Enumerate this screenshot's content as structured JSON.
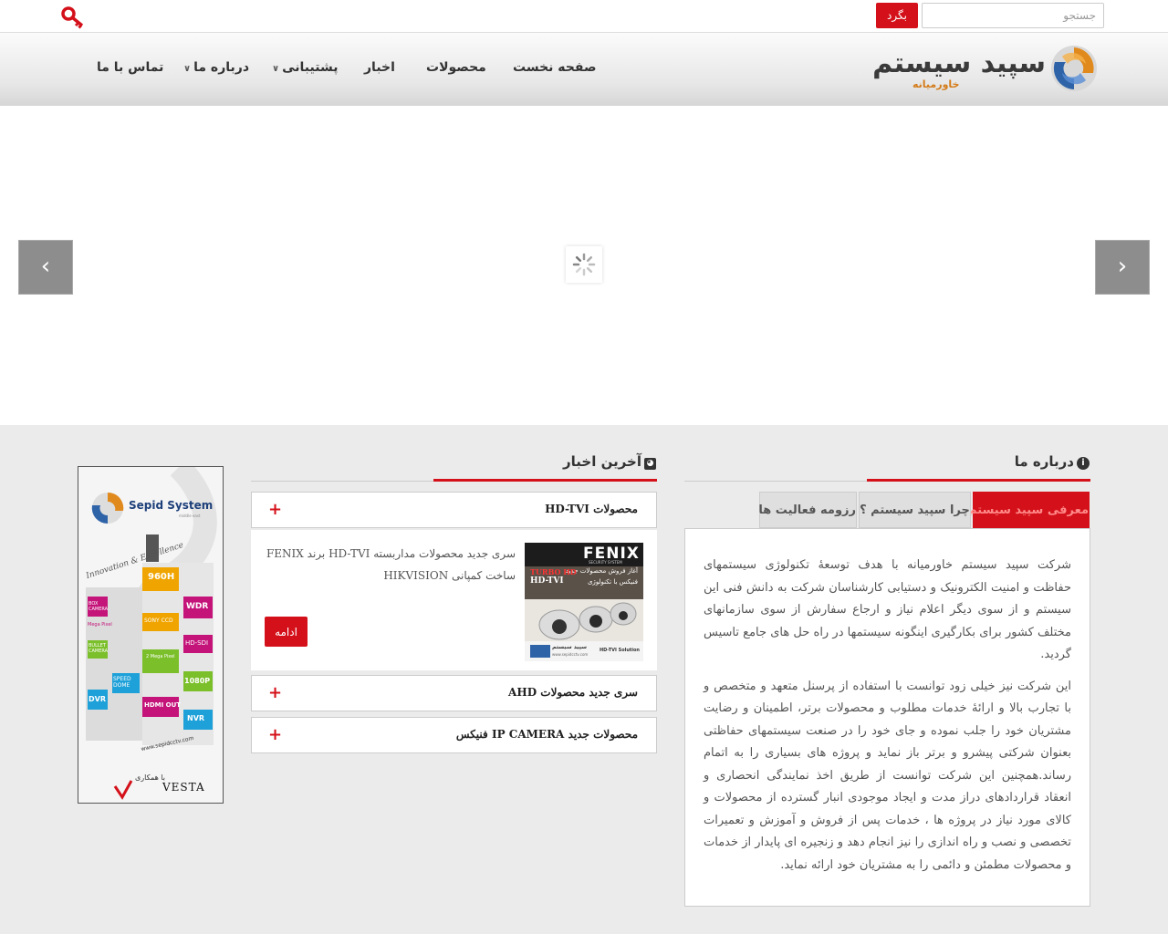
{
  "topbar": {
    "search_placeholder": "جستجو",
    "search_button": "بگرد"
  },
  "logo": {
    "name": "سپید سیستم",
    "subtitle": "خاورمیانه"
  },
  "nav": {
    "items": [
      {
        "label": "صفحه نخست"
      },
      {
        "label": "محصولات"
      },
      {
        "label": "اخبار"
      },
      {
        "label": "پشتیبانی",
        "has_submenu": true
      },
      {
        "label": "درباره ما",
        "has_submenu": true
      },
      {
        "label": "تماس با ما"
      }
    ]
  },
  "about": {
    "title": "درباره ما",
    "tabs": [
      {
        "label": "معرفی سپید سیستم",
        "active": true
      },
      {
        "label": "چرا سپید سیستم ؟",
        "active": false
      },
      {
        "label": "رزومه فعالیت ها",
        "active": false
      }
    ],
    "paragraphs": [
      "شرکت سپید سیستم خاورمیانه با هدف توسعهٔ تکنولوژی سیستمهای حفاظت و امنیت الکترونیک و دستیابی کارشناسان شرکت به دانش فنی این سیستم و از سوی دیگر اعلام نیاز و ارجاع سفارش از سوی سازمانهای مختلف کشور برای بکارگیری اینگونه سیستمها در راه حل های جامع تاسیس گردید.",
      "این شرکت نیز خیلی زود توانست با استفاده از پرسنل متعهد و متخصص و با تجارب بالا و ارائهٔ خدمات مطلوب و محصولات برتر، اطمینان و رضایت مشتریان خود را جلب نموده و جای خود را در صنعت سیستمهای حفاظتی بعنوان شرکتی پیشرو و برتر باز نماید و پروژه های بسیاری را به اتمام رساند.همچنین این شرکت توانست از طریق اخذ نمایندگی انحصاری و انعقاد قراردادهای دراز مدت و ایجاد موجودی انبار گسترده از محصولات و کالای مورد نیاز در پروژه ها ، خدمات پس از فروش و آموزش و تعمیرات تخصصی و نصب و راه اندازی را نیز انجام دهد و زنجیره ای پایدار از خدمات و محصولات مطمئن و دائمی را به مشتریان خود ارائه نماید."
    ]
  },
  "news": {
    "title": "آخرین اخبار",
    "items": [
      {
        "title": "محصولات HD-TVI",
        "expanded": true
      },
      {
        "title": "سری جدید محصولات AHD",
        "expanded": false
      },
      {
        "title": "محصولات جدید IP CAMERA فنیکس",
        "expanded": false
      }
    ],
    "expanded_text": "سری جدید محصولات مداربسته HD-TVI برند FENIX ساخت کمپانی HIKVISION",
    "more_button": "ادامه",
    "image": {
      "brand": "FENIX",
      "brand_sub": "SECURITY SYSTEM",
      "line1": "آغاز فروش محصولات جدید",
      "line2": "TURBO HD",
      "line3": "HD-TVI",
      "line4": "فنیکس با تکنولوژی",
      "footer": "HD-TVI Solution",
      "logo_text": "سپید سیستم",
      "url": "www.sepidcctv.com"
    }
  },
  "banner": {
    "brand": "Sepid System",
    "brand_sub": "middle east",
    "tagline": "Innovation & Excellence",
    "features_left": [
      "BOX CAMERA",
      "Mega Pixel",
      "BULLET CAMERA",
      "SPEED DOME",
      "DVR"
    ],
    "features_mid": [
      "960H",
      "SONY CCD",
      "2 Mega Pixel",
      "HDMI OUT"
    ],
    "features_right": [
      "WDR",
      "HD-SDI",
      "1080P",
      "NVR"
    ],
    "url": "www.sepidcctv.com",
    "partner": "VESTA",
    "partner_prefix": "با همکاری"
  },
  "colors": {
    "accent": "#d4111a",
    "logo_orange": "#e08a1e",
    "logo_blue": "#2f63a8"
  }
}
